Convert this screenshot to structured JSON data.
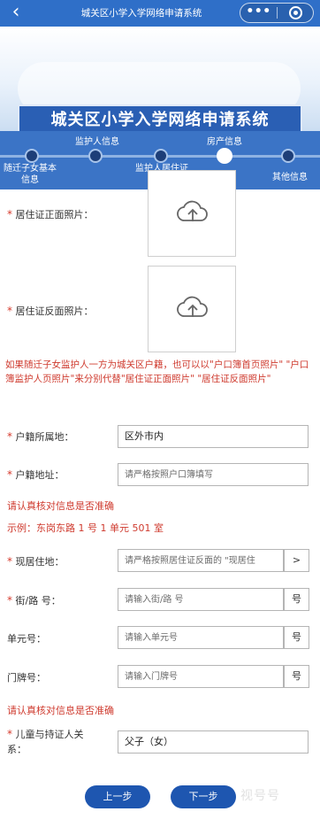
{
  "topbar": {
    "back_icon": "chevron-left-icon",
    "title": "城关区小学入学网络申请系统",
    "more_label": "•••",
    "close_icon": "target-close-icon"
  },
  "header": {
    "banner_title": "城关区小学入学网络申请系统",
    "steps": [
      {
        "label": "随迁子女基本\n信息",
        "state": "done"
      },
      {
        "label": "监护人信息",
        "state": "done"
      },
      {
        "label": "监护人居住证\n信息",
        "state": "done"
      },
      {
        "label": "房产信息",
        "state": "active"
      },
      {
        "label": "其他信息",
        "state": "todo"
      }
    ]
  },
  "uploads": {
    "front_label": "居住证正面照片：",
    "back_label": "居住证反面照片：",
    "icon": "cloud-upload-icon"
  },
  "notice_text": "如果随迁子女监护人一方为城关区户籍，也可以以\"户口簿首页照片\" \"户口簿监护人页照片\"来分别代替\"居住证正面照片\" \"居住证反面照片\"",
  "form": {
    "hukou_location": {
      "label": "户籍所属地：",
      "value": "区外市内"
    },
    "hukou_address": {
      "label": "户籍地址：",
      "placeholder": "请严格按照户口簿填写"
    },
    "verify_hint_1": "请认真核对信息是否准确",
    "example": "示例：东岗东路 1 号 1 单元 501 室",
    "current_address": {
      "label": "现居住地：",
      "placeholder": "请严格按照居住证反面的 \"现居住",
      "button": ">"
    },
    "street": {
      "label": "街/路 号：",
      "placeholder": "请输入街/路 号",
      "button": "号"
    },
    "unit": {
      "label": "单元号：",
      "placeholder": "请输入单元号",
      "button": "号"
    },
    "door": {
      "label": "门牌号：",
      "placeholder": "请输入门牌号",
      "button": "号"
    },
    "verify_hint_2": "请认真核对信息是否准确",
    "relation": {
      "label_line1": "儿童与持证人关",
      "label_line2": "系：",
      "value": "父子（女）"
    }
  },
  "buttons": {
    "prev": "上一步",
    "next": "下一步"
  },
  "watermark": "视号号",
  "colors": {
    "primary": "#1e56b0",
    "banner": "#2a5fb4",
    "warning": "#cf3a2e",
    "topbar": "#2f6fc8"
  }
}
